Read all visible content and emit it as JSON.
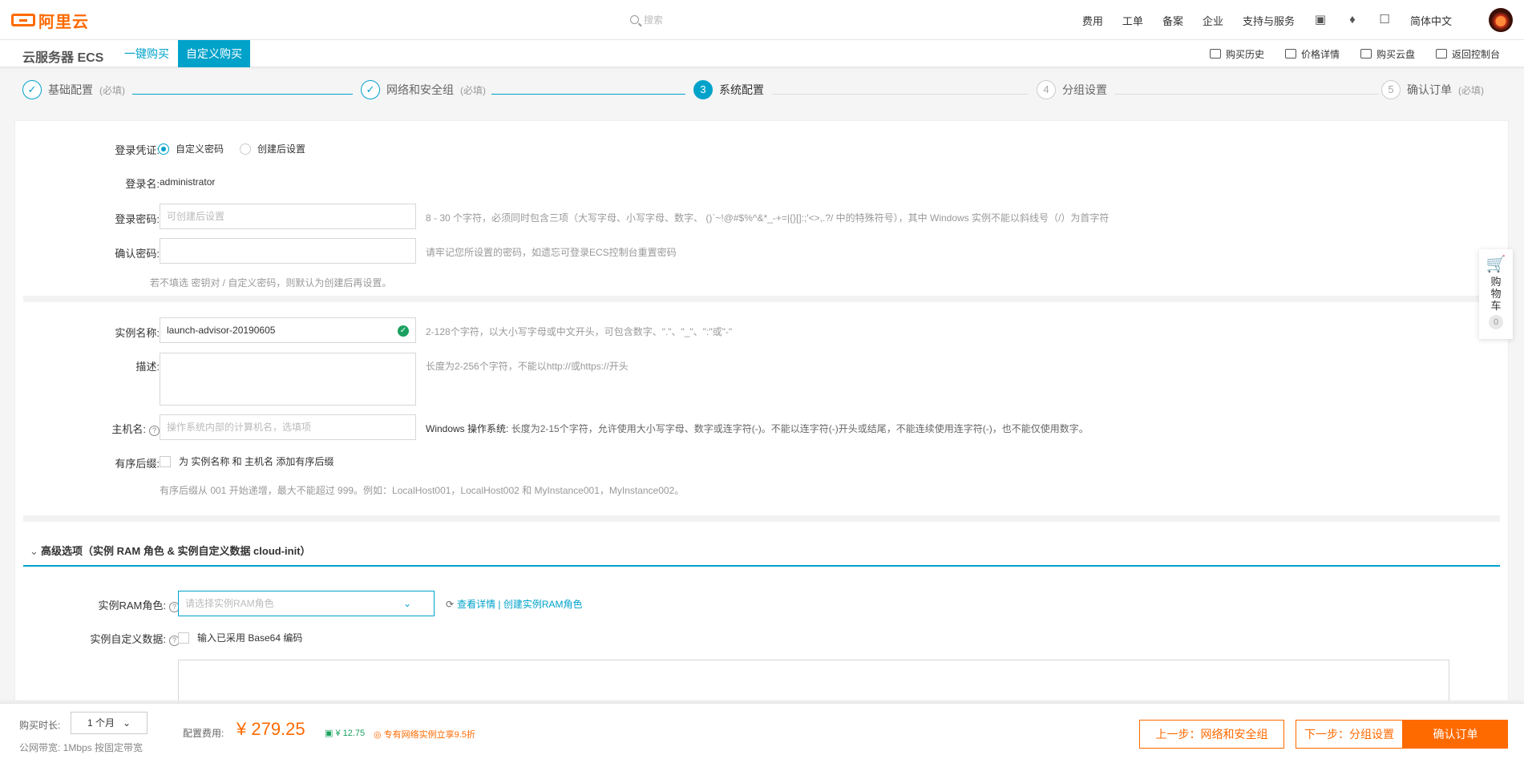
{
  "topnav": {
    "logo_text": "阿里云",
    "search_placeholder": "搜索",
    "links": [
      "费用",
      "工单",
      "备案",
      "企业",
      "支持与服务"
    ],
    "lang": "简体中文"
  },
  "subnav": {
    "product": "云服务器 ECS",
    "tab_quick": "一键购买",
    "tab_custom": "自定义购买",
    "history": "购买历史",
    "price_detail": "价格详情",
    "buy_disk": "购买云盘",
    "back_console": "返回控制台"
  },
  "steps": [
    {
      "label": "基础配置",
      "req": "(必填)",
      "num": "✓"
    },
    {
      "label": "网络和安全组",
      "req": "(必填)",
      "num": "✓"
    },
    {
      "label": "系统配置",
      "req": "",
      "num": "3"
    },
    {
      "label": "分组设置",
      "req": "",
      "num": "4"
    },
    {
      "label": "确认订单",
      "req": "(必填)",
      "num": "5"
    }
  ],
  "login": {
    "cred_label": "登录凭证:",
    "opt_custom": "自定义密码",
    "opt_later": "创建后设置",
    "name_label": "登录名:",
    "name_value": "administrator",
    "pwd_label": "登录密码:",
    "pwd_placeholder": "可创建后设置",
    "pwd_hint": "8 - 30 个字符，必须同时包含三项（大写字母、小写字母、数字、 ()`~!@#$%^&*_-+=|{}[]:;'<>,.?/ 中的特殊符号），其中 Windows 实例不能以斜线号（/）为首字符",
    "confirm_label": "确认密码:",
    "confirm_hint": "请牢记您所设置的密码，如遗忘可登录ECS控制台重置密码",
    "note": "若不填选 密钥对 / 自定义密码，则默认为创建后再设置。"
  },
  "instance": {
    "name_label": "实例名称:",
    "name_value": "launch-advisor-20190605",
    "name_hint": "2-128个字符，以大小写字母或中文开头，可包含数字、\".\"、\"_\"、\":\"或\"-\"",
    "desc_label": "描述:",
    "desc_hint": "长度为2-256个字符，不能以http://或https://开头",
    "host_label": "主机名:",
    "host_placeholder": "操作系统内部的计算机名，选填项",
    "host_hint_bold": "Windows 操作系统:",
    "host_hint": "长度为2-15个字符，允许使用大小写字母、数字或连字符(-)。不能以连字符(-)开头或结尾，不能连续使用连字符(-)，也不能仅使用数字。",
    "seq_label": "有序后缀:",
    "seq_text": "为 实例名称 和 主机名 添加有序后缀",
    "seq_hint": "有序后缀从 001 开始递增，最大不能超过 999。例如：LocalHost001，LocalHost002 和 MyInstance001，MyInstance002。"
  },
  "advanced": {
    "title": "高级选项（实例 RAM 角色 & 实例自定义数据 cloud-init）",
    "ram_label": "实例RAM角色:",
    "ram_placeholder": "请选择实例RAM角色",
    "ram_links": "查看详情 | 创建实例RAM角色",
    "userdata_label": "实例自定义数据:",
    "base64_text": "输入已采用 Base64 编码"
  },
  "cart": {
    "label": "购物车",
    "count": "0"
  },
  "bottom": {
    "duration_label": "购买时长:",
    "duration_value": "1 个月",
    "bandwidth": "公网带宽: 1Mbps 按固定带宽",
    "fee_label": "配置费用:",
    "price": "¥ 279.25",
    "save": "¥ 12.75",
    "promo": "专有网络实例立享9.5折",
    "prev": "上一步：网络和安全组",
    "next": "下一步：分组设置",
    "confirm": "确认订单"
  }
}
